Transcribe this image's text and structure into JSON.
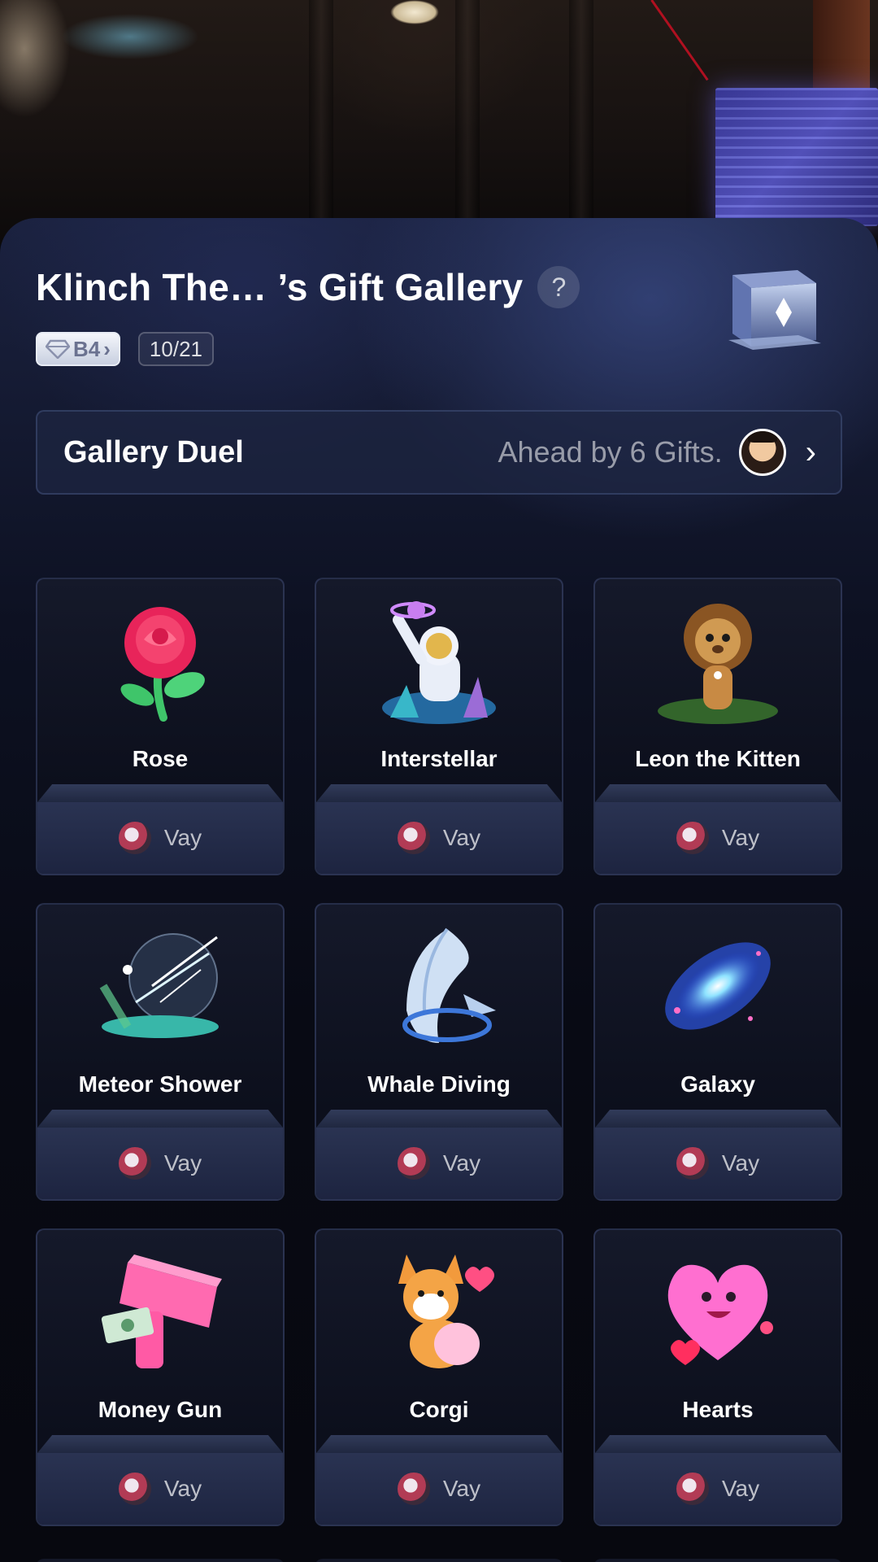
{
  "header": {
    "title": "Klinch The… ’s Gift Gallery",
    "help_label": "?",
    "level_badge": "B4",
    "level_chevron": "›",
    "progress_count": "10/21"
  },
  "duel": {
    "title": "Gallery Duel",
    "status": "Ahead by 6 Gifts.",
    "chevron": "›"
  },
  "gifts": [
    {
      "name": "Rose",
      "sender": "Vay",
      "icon": "rose-icon"
    },
    {
      "name": "Interstellar",
      "sender": "Vay",
      "icon": "astronaut-icon"
    },
    {
      "name": "Leon the Kitten",
      "sender": "Vay",
      "icon": "lion-icon"
    },
    {
      "name": "Meteor Shower",
      "sender": "Vay",
      "icon": "meteor-icon"
    },
    {
      "name": "Whale Diving",
      "sender": "Vay",
      "icon": "whale-icon"
    },
    {
      "name": "Galaxy",
      "sender": "Vay",
      "icon": "galaxy-icon"
    },
    {
      "name": "Money Gun",
      "sender": "Vay",
      "icon": "money-gun-icon"
    },
    {
      "name": "Corgi",
      "sender": "Vay",
      "icon": "corgi-icon"
    },
    {
      "name": "Hearts",
      "sender": "Vay",
      "icon": "hearts-icon"
    }
  ]
}
